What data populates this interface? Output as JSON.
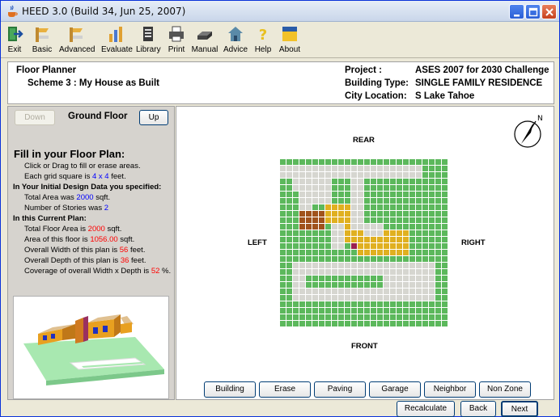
{
  "window": {
    "title": "HEED 3.0 (Build 34, Jun 25, 2007)"
  },
  "toolbar": {
    "items": [
      {
        "label": "Exit",
        "icon": "exit-icon"
      },
      {
        "label": "Basic",
        "icon": "basic-icon"
      },
      {
        "label": "Advanced",
        "icon": "advanced-icon"
      },
      {
        "label": "Evaluate",
        "icon": "evaluate-icon"
      },
      {
        "label": "Library",
        "icon": "library-icon"
      },
      {
        "label": "Print",
        "icon": "print-icon"
      },
      {
        "label": "Manual",
        "icon": "manual-icon"
      },
      {
        "label": "Advice",
        "icon": "advice-icon"
      },
      {
        "label": "Help",
        "icon": "help-icon"
      },
      {
        "label": "About",
        "icon": "about-icon"
      }
    ]
  },
  "info": {
    "tool_name": "Floor Planner",
    "scheme": "Scheme 3 : My House as Built",
    "project_label": "Project :",
    "project_value": "ASES 2007 for 2030 Challenge",
    "building_type_label": "Building Type:",
    "building_type_value": "SINGLE FAMILY RESIDENCE",
    "city_label": "City Location:",
    "city_value": "S Lake Tahoe"
  },
  "floor_nav": {
    "down_label": "Down",
    "floor_name": "Ground Floor",
    "up_label": "Up"
  },
  "instructions": {
    "title": "Fill in your Floor Plan:",
    "line1": "Click or Drag to fill or erase areas.",
    "grid_prefix": "Each grid square is ",
    "grid_value": "4 x 4",
    "grid_suffix": " feet.",
    "initial_heading": "In Your Initial Design Data you specified:",
    "total_area_prefix": "Total Area was ",
    "total_area_value": "2000",
    "total_area_suffix": " sqft.",
    "stories_prefix": "Number of Stories was ",
    "stories_value": "2",
    "current_heading": "In this Current Plan:",
    "floor_area_prefix": "Total Floor Area is ",
    "floor_area_value": "2000",
    "floor_area_suffix": " sqft.",
    "area_floor_prefix": "Area of this floor is ",
    "area_floor_value": "1056.00",
    "area_floor_suffix": " sqft.",
    "width_prefix": "Overall Width of this plan is ",
    "width_value": "56",
    "width_suffix": " feet.",
    "depth_prefix": "Overall Depth of this plan is ",
    "depth_value": "36",
    "depth_suffix": " feet.",
    "coverage_prefix": "Coverage of overall Width x Depth is ",
    "coverage_value": "52",
    "coverage_suffix": " %."
  },
  "plan": {
    "rear": "REAR",
    "front": "FRONT",
    "left": "LEFT",
    "right": "RIGHT",
    "compass_letter": "N"
  },
  "zones": [
    "Building",
    "Erase",
    "Paving",
    "Garage",
    "Neighbor",
    "Non Zone"
  ],
  "nav": {
    "recalculate": "Recalculate",
    "back": "Back",
    "next": "Next"
  },
  "colors": {
    "grass": "#5cb85c",
    "paving": "#d6d6d0",
    "building": "#e0b020",
    "garage": "#a0521c",
    "accent_red": "#ff0000",
    "accent_blue": "#0000ff"
  }
}
